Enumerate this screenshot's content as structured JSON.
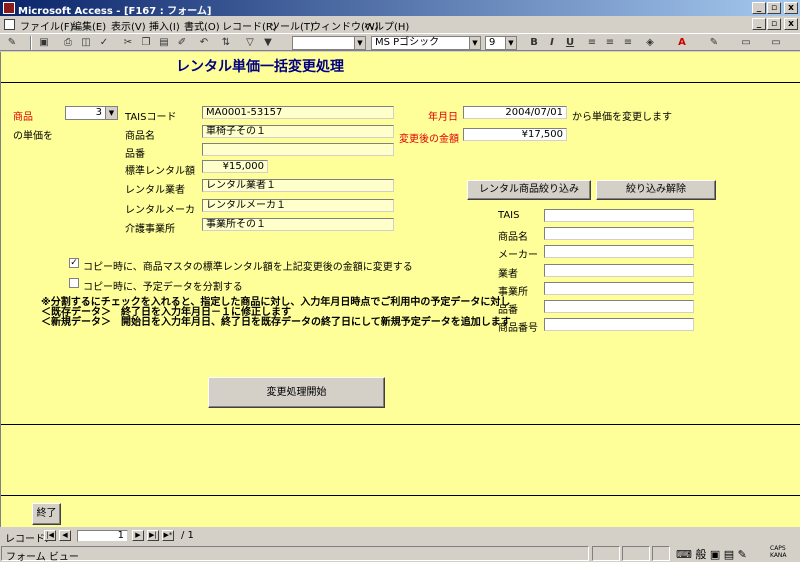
{
  "window": {
    "title": "Microsoft Access - [F167 : フォーム]",
    "buttons": {
      "minimize": "_",
      "restore": "▫",
      "close": "x"
    }
  },
  "menu": [
    "ファイル(F)",
    "編集(E)",
    "表示(V)",
    "挿入(I)",
    "書式(O)",
    "レコード(R)",
    "ツール(T)",
    "ウィンドウ(W)",
    "ヘルプ(H)"
  ],
  "toolbar": {
    "font_name": "MS Pゴシック",
    "font_size": "9",
    "bold": "B",
    "italic": "I",
    "underline": "U"
  },
  "form": {
    "title": "レンタル単価一括変更処理",
    "product_label": "商品",
    "product_combo": "3",
    "unit_price_of": "の単価を",
    "tais_code_label": "TAISコード",
    "tais_code_value": "MA0001-53157",
    "product_name_label": "商品名",
    "product_name_value": "車椅子その１",
    "part_no_label": "品番",
    "part_no_value": "",
    "std_rental_label": "標準レンタル額",
    "std_rental_value": "¥15,000",
    "rental_vendor_label": "レンタル業者",
    "rental_vendor_value": "レンタル業者１",
    "rental_maker_label": "レンタルメーカ",
    "rental_maker_value": "レンタルメーカ１",
    "care_office_label": "介護事業所",
    "care_office_value": "事業所その１",
    "date_label": "年月日",
    "date_value": "2004/07/01",
    "date_suffix": "から単価を変更します",
    "new_amount_label": "変更後の金額",
    "new_amount_value": "¥17,500",
    "filter_button": "レンタル商品絞り込み",
    "clear_filter_button": "絞り込み解除",
    "filters": [
      {
        "label": "TAIS",
        "value": ""
      },
      {
        "label": "商品名",
        "value": ""
      },
      {
        "label": "メーカー",
        "value": ""
      },
      {
        "label": "業者",
        "value": ""
      },
      {
        "label": "事業所",
        "value": ""
      },
      {
        "label": "品番",
        "value": ""
      },
      {
        "label": "商品番号",
        "value": ""
      }
    ],
    "check1_label": "コピー時に、商品マスタの標準レンタル額を上記変更後の金額に変更する",
    "check1_checked": "✓",
    "check2_label": "コピー時に、予定データを分割する",
    "note1": "※分割するにチェックを入れると、指定した商品に対し、入力年月日時点でご利用中の予定データに対し",
    "note2": "＜既存データ＞　終了日を入力年月日－１に修正します",
    "note3": "＜新規データ＞　開始日を入力年月日、終了日を既存データの終了日にして新規予定データを追加します",
    "start_button": "変更処理開始",
    "exit_button": "終了"
  },
  "record_nav": {
    "label": "レコード:",
    "current": "1",
    "total": "/ 1"
  },
  "status": {
    "view": "フォーム ビュー",
    "caps": "CAPS KANA"
  }
}
